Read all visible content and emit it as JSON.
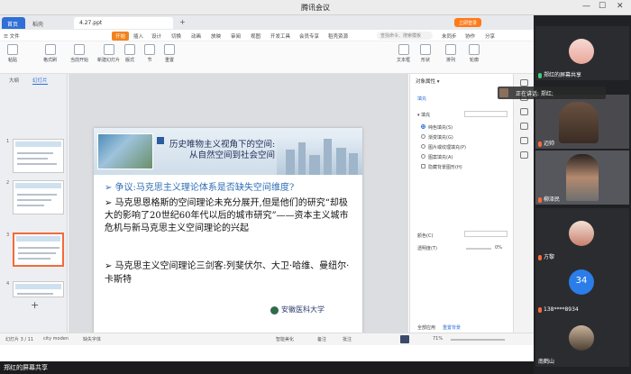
{
  "window": {
    "title": "腾讯会议",
    "minimize": "—",
    "maximize": "☐",
    "close": "✕"
  },
  "wps": {
    "tabs": {
      "home": "首页",
      "daoke": "稻壳",
      "doc": "4.27.ppt",
      "add": "+"
    },
    "login_button": "立即登录",
    "menus": [
      "☰ 文件",
      "开始",
      "插入",
      "设计",
      "切换",
      "动画",
      "放映",
      "审阅",
      "视图",
      "开发工具",
      "会员专享",
      "稻壳资源"
    ],
    "search_placeholder": "查找命令、搜索模板",
    "right_menus": [
      "未同步",
      "协作",
      "分享"
    ],
    "ribbon": [
      "粘贴",
      "格式刷",
      "当前开始",
      "新建幻灯片",
      "版式",
      "节",
      "重置",
      "文本框",
      "形状",
      "排列",
      "轮廓"
    ],
    "left_tabs": [
      "大纲",
      "幻灯片"
    ],
    "slide_numbers": [
      "1",
      "2",
      "3",
      "4"
    ],
    "add_slide": "+",
    "slide": {
      "title1": "历史唯物主义视角下的空间:",
      "title2": "从自然空间到社会空间",
      "point1": "➢ 争议:马克思主义理论体系是否缺失空间维度?",
      "point2": "➢ 马克思恩格斯的空间理论未充分展开,但是他们的研究“却极大的影响了20世纪60年代以后的城市研究”——资本主义城市危机与新马克思主义空间理论的兴起",
      "point3": "➢ 马克思主义空间理论三剑客:列斐伏尔、大卫·哈维、曼纽尔·卡斯特",
      "logo": "安徽医科大学"
    },
    "right_panel": {
      "title": "对象属性 ▾",
      "tab": "填充",
      "section": "▾ 填充",
      "options": [
        "纯色填充(S)",
        "渐变填充(G)",
        "图片或纹理填充(P)",
        "图案填充(A)",
        "隐藏背景图形(H)"
      ],
      "color_label": "颜色(C)",
      "transparency_label": "透明度(T)",
      "transparency_value": "0%",
      "apply_all": "全部应用",
      "reset": "重置背景"
    },
    "status": {
      "slide_info": "幻灯片 3 / 11",
      "theme": "city moden",
      "font": "缺失字体",
      "beautify": "智能美化",
      "notes": "备注",
      "comment": "批注",
      "zoom": "71%"
    }
  },
  "share_label": "郑红的屏幕共享",
  "participants": [
    {
      "name": "郑红的屏幕共享",
      "mic_color": "#3ad07a"
    },
    {
      "name": "迈帅",
      "mic_color": "#ff6a3d"
    },
    {
      "name": "柳泽民",
      "mic_color": "#ff6a3d"
    },
    {
      "name": "方黎",
      "mic_color": "#ff6a3d"
    },
    {
      "name": "138****8934",
      "mic_color": "#ff6a3d",
      "avatar_text": "34"
    },
    {
      "name": "南鹤山",
      "mic_color": "#ff6a3d"
    }
  ],
  "speaking": "正在讲话: 郑红;",
  "colors": {
    "accent": "#2f6fd6",
    "wps_orange": "#f2821d",
    "selected_slide": "#f26b3a"
  }
}
